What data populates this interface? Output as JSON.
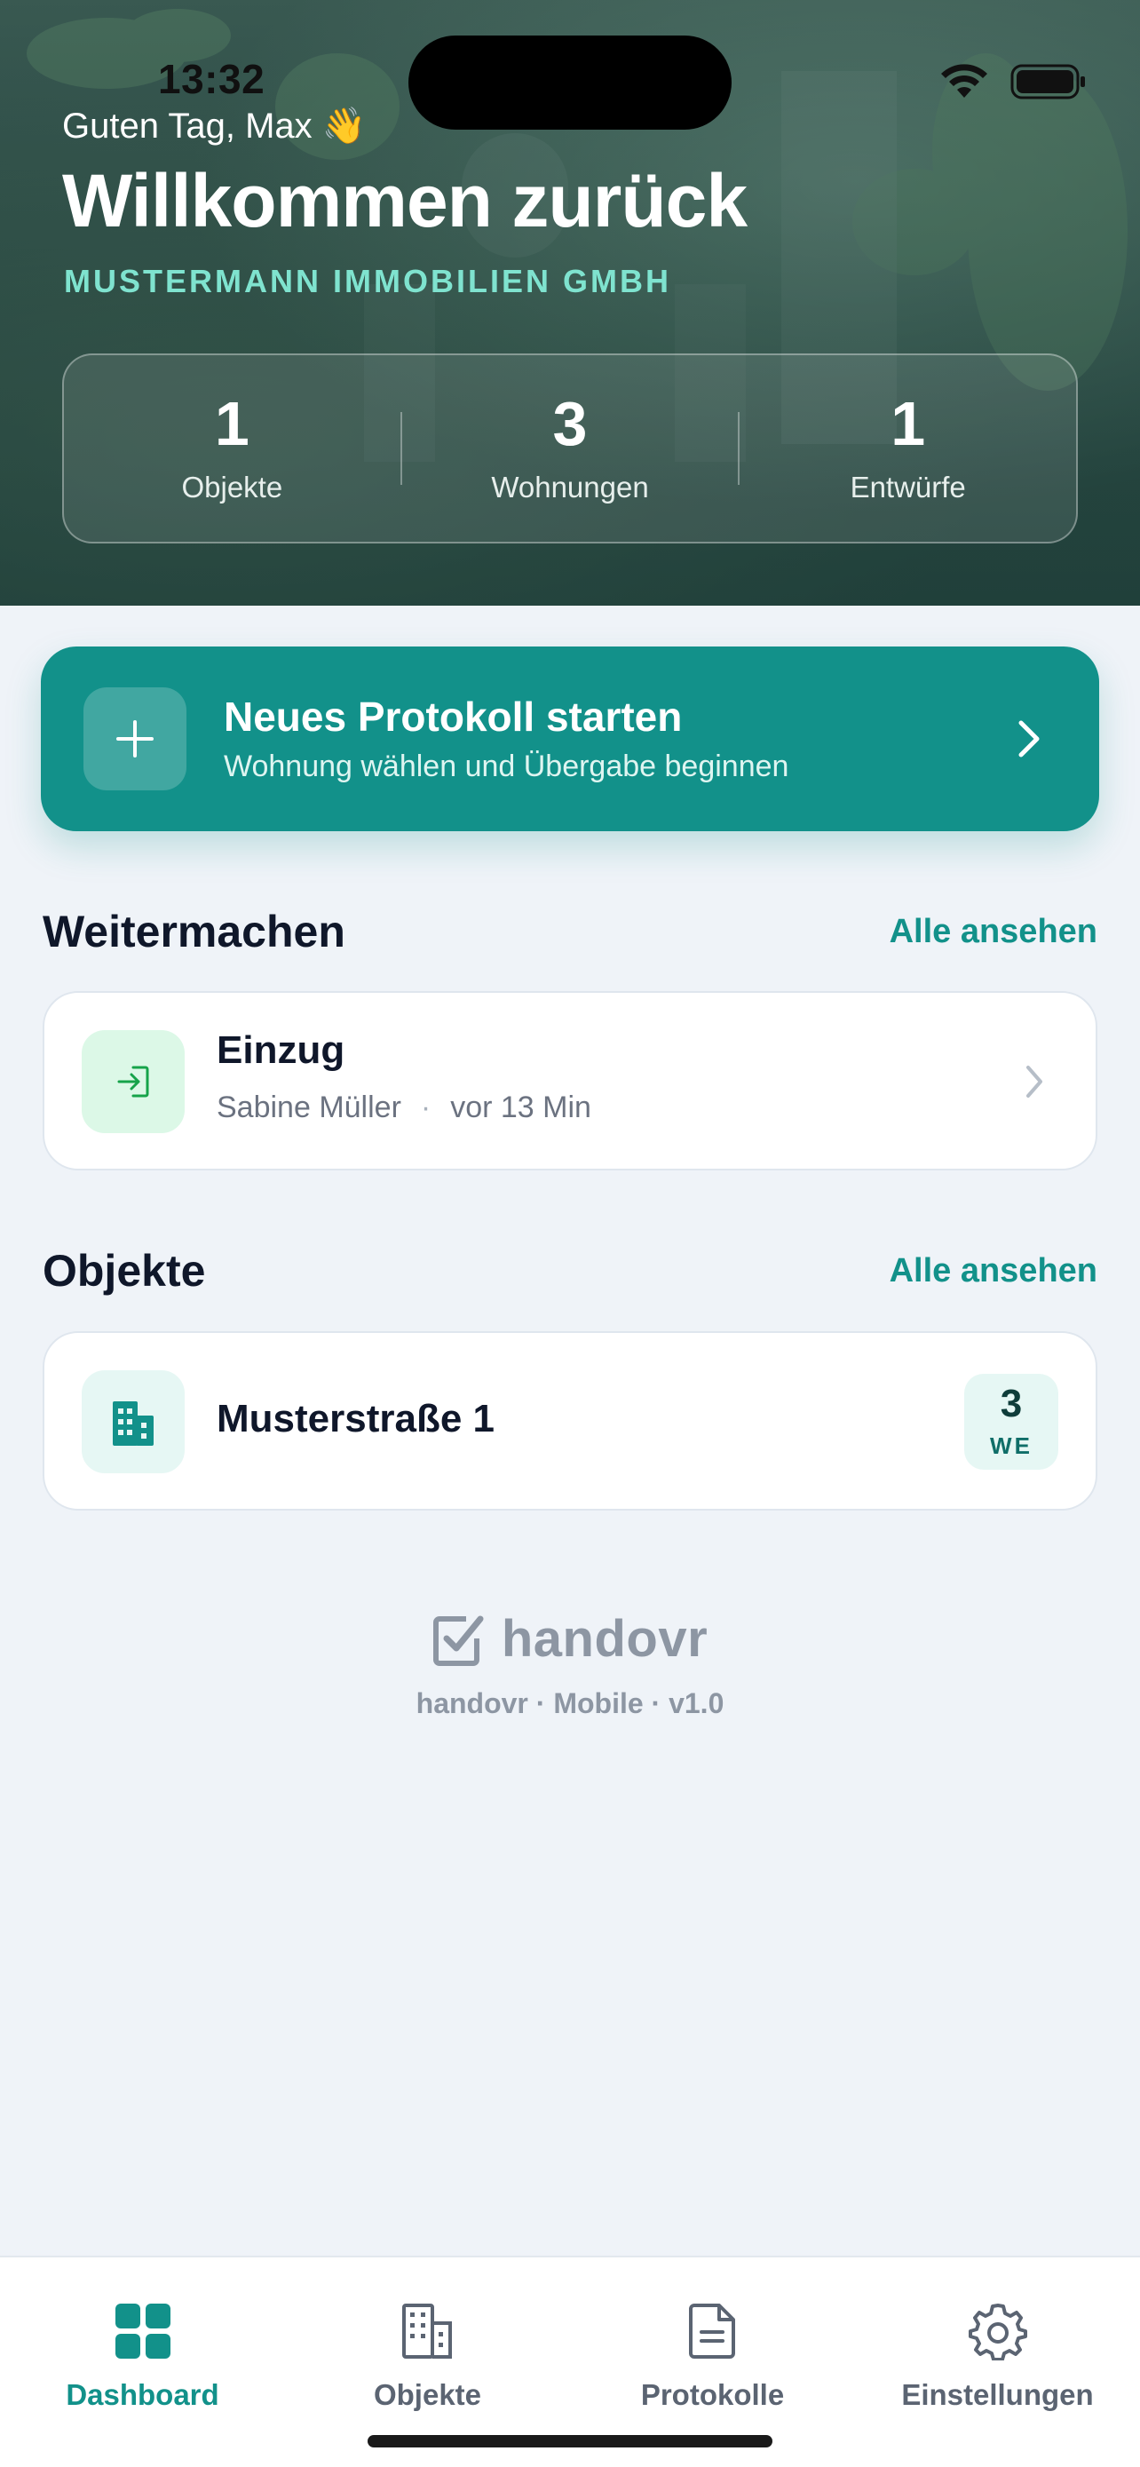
{
  "status_bar": {
    "time": "13:32"
  },
  "hero": {
    "greeting": "Guten Tag, Max 👋",
    "title": "Willkommen zurück",
    "company": "MUSTERMANN IMMOBILIEN GMBH",
    "stats": [
      {
        "value": "1",
        "label": "Objekte"
      },
      {
        "value": "3",
        "label": "Wohnungen"
      },
      {
        "value": "1",
        "label": "Entwürfe"
      }
    ]
  },
  "cta": {
    "title": "Neues Protokoll starten",
    "subtitle": "Wohnung wählen und Übergabe beginnen"
  },
  "continue_section": {
    "title": "Weitermachen",
    "link": "Alle ansehen",
    "item": {
      "title": "Einzug",
      "person": "Sabine Müller",
      "separator": "·",
      "time": "vor 13 Min"
    }
  },
  "objects_section": {
    "title": "Objekte",
    "link": "Alle ansehen",
    "item": {
      "title": "Musterstraße 1",
      "count": "3",
      "unit": "WE"
    }
  },
  "brand": {
    "name": "handovr",
    "version": "handovr · Mobile · v1.0"
  },
  "tabbar": {
    "tabs": [
      {
        "label": "Dashboard",
        "icon": "dashboard-icon",
        "active": true
      },
      {
        "label": "Objekte",
        "icon": "building-icon",
        "active": false
      },
      {
        "label": "Protokolle",
        "icon": "document-icon",
        "active": false
      },
      {
        "label": "Einstellungen",
        "icon": "gear-icon",
        "active": false
      }
    ]
  },
  "colors": {
    "accent": "#12918a",
    "company": "#7fe3cf",
    "background": "#eff3f8"
  }
}
